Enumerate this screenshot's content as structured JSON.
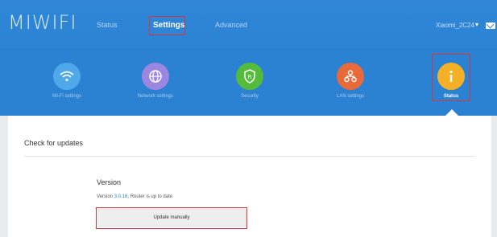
{
  "header": {
    "logo": "MIWIFI",
    "tabs": [
      {
        "label": "Status"
      },
      {
        "label": "Settings"
      },
      {
        "label": "Advanced"
      }
    ],
    "account": "Xiaomi_2C24",
    "chevron": "▾"
  },
  "settings_nav": {
    "items": [
      {
        "label": "Wi-Fi settings",
        "icon": "wifi-icon",
        "color": "#4fa8e9"
      },
      {
        "label": "Network settings",
        "icon": "globe-icon",
        "color": "#9b86e0"
      },
      {
        "label": "Security",
        "icon": "shield-icon",
        "color": "#55bb3d"
      },
      {
        "label": "LAN settings",
        "icon": "lan-icon",
        "color": "#e86a3b"
      },
      {
        "label": "Status",
        "icon": "info-icon",
        "color": "#f4b127"
      }
    ]
  },
  "content": {
    "section_title": "Check for updates",
    "version_title": "Version",
    "version_prefix": "Version ",
    "version_number": "3.0.16",
    "version_suffix": ", Router is up to date",
    "update_button": "Update manually"
  },
  "colors": {
    "header_blue": "#2f86d6",
    "highlight_red": "#d4363b",
    "link_blue": "#2d84d4"
  }
}
